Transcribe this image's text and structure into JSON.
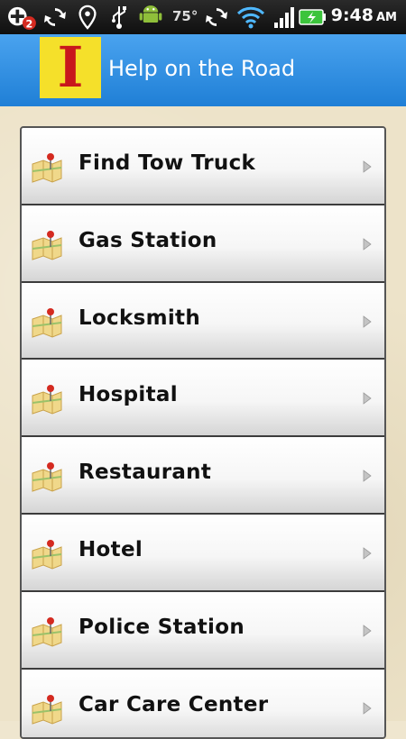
{
  "status_bar": {
    "notification_count": "2",
    "temperature": "75°",
    "time": "9:48",
    "ampm": "AM"
  },
  "header": {
    "logo_letter": "I",
    "title": "Help on the Road"
  },
  "menu": {
    "items": [
      {
        "label": "Find Tow Truck"
      },
      {
        "label": "Gas Station"
      },
      {
        "label": "Locksmith"
      },
      {
        "label": "Hospital"
      },
      {
        "label": "Restaurant"
      },
      {
        "label": "Hotel"
      },
      {
        "label": "Police Station"
      },
      {
        "label": "Car Care Center"
      }
    ]
  },
  "colors": {
    "title_bar": "#2b8ae0",
    "logo_bg": "#f5e02a",
    "logo_letter": "#c8171c",
    "background": "#ede3c9"
  }
}
